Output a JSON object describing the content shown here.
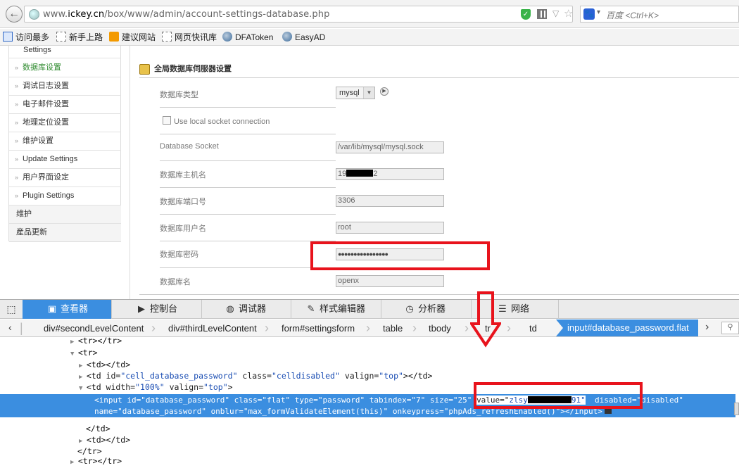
{
  "browser": {
    "url_prefix": "www.",
    "url_domain": "ickey.cn",
    "url_path": "/box/www/admin/account-settings-database.php",
    "search_placeholder": "百度 <Ctrl+K>",
    "search_engine_icon": "paw-icon"
  },
  "bookmarks": [
    {
      "label": "访问最多",
      "icon": "sidebar-icon"
    },
    {
      "label": "新手上路",
      "icon": "dashed-folder-icon"
    },
    {
      "label": "建议网站",
      "icon": "orange-bookmark-icon"
    },
    {
      "label": "网页快讯库",
      "icon": "dashed-folder-icon"
    },
    {
      "label": "DFAToken",
      "icon": "globe-icon"
    },
    {
      "label": "EasyAD",
      "icon": "globe-icon"
    }
  ],
  "leftnav": {
    "partial_top": "Settings",
    "items": [
      "数据库设置",
      "调试日志设置",
      "电子邮件设置",
      "地理定位设置",
      "维护设置",
      "Update Settings",
      "用户界面设定",
      "Plugin Settings"
    ],
    "groups": [
      "维护",
      "産品更新"
    ]
  },
  "form": {
    "section_title": "全局数据库伺服器设置",
    "db_type_label": "数据库类型",
    "db_type_value": "mysql",
    "socket_checkbox_label": "Use local socket connection",
    "socket_label": "Database Socket",
    "socket_value": "/var/lib/mysql/mysql.sock",
    "host_label": "数据库主机名",
    "host_value_visible_start": "19",
    "host_value_visible_end": "2",
    "port_label": "数据库端口号",
    "port_value": "3306",
    "user_label": "数据库用户名",
    "user_value": "root",
    "password_label": "数据库密码",
    "password_value": "●●●●●●●●●●●●●●●●",
    "dbname_label": "数据库名",
    "dbname_value": "openx"
  },
  "devtools": {
    "tabs": [
      {
        "label": "查看器",
        "icon": "inspector-icon"
      },
      {
        "label": "控制台",
        "icon": "console-icon"
      },
      {
        "label": "调试器",
        "icon": "debugger-icon"
      },
      {
        "label": "样式编辑器",
        "icon": "style-editor-icon"
      },
      {
        "label": "分析器",
        "icon": "profiler-icon"
      },
      {
        "label": "网络",
        "icon": "network-icon"
      }
    ],
    "breadcrumbs": [
      "div#secondLevelContent",
      "div#thirdLevelContent",
      "form#settingsform",
      "table",
      "tbody",
      "tr",
      "td"
    ],
    "active_crumb": "input#database_password.flat",
    "code": {
      "l1": "<tr></tr>",
      "l2": "<tr>",
      "l3": "<td></td>",
      "l4_pre": "<td ",
      "l4_attr1": "id=",
      "l4_val1": "\"cell_database_password\"",
      "l4_attr2": " class=",
      "l4_val2": "\"celldisabled\"",
      "l4_attr3": " valign=",
      "l4_val3": "\"top\"",
      "l4_post": "></td>",
      "l5_pre": "<td ",
      "l5_attr1": "width=",
      "l5_val1": "\"100%\"",
      "l5_attr2": " valign=",
      "l5_val2": "\"top\"",
      "l5_post": ">",
      "sel_line1_a": "<input id=\"database_password\" class=\"flat\" type=\"password\" tabindex=\"7\" size=\"25\"",
      "sel_value_attr": "value=\"",
      "sel_value_start": "zlsy",
      "sel_value_end": "91\"",
      "sel_line1_b": "disabled=\"disabled\"",
      "sel_line2": "name=\"database_password\" onblur=\"max_formValidateElement(this)\" onkeypress=\"phpAds_refreshEnabled()\"></input>",
      "l8": "</td>",
      "l9": "<td></td>",
      "l10": "</tr>",
      "l11": "<tr></tr>"
    }
  },
  "annotation_colors": {
    "highlight": "#e8131c",
    "devtools_accent": "#3b8ee0",
    "nav_active": "#2d8a2d"
  }
}
